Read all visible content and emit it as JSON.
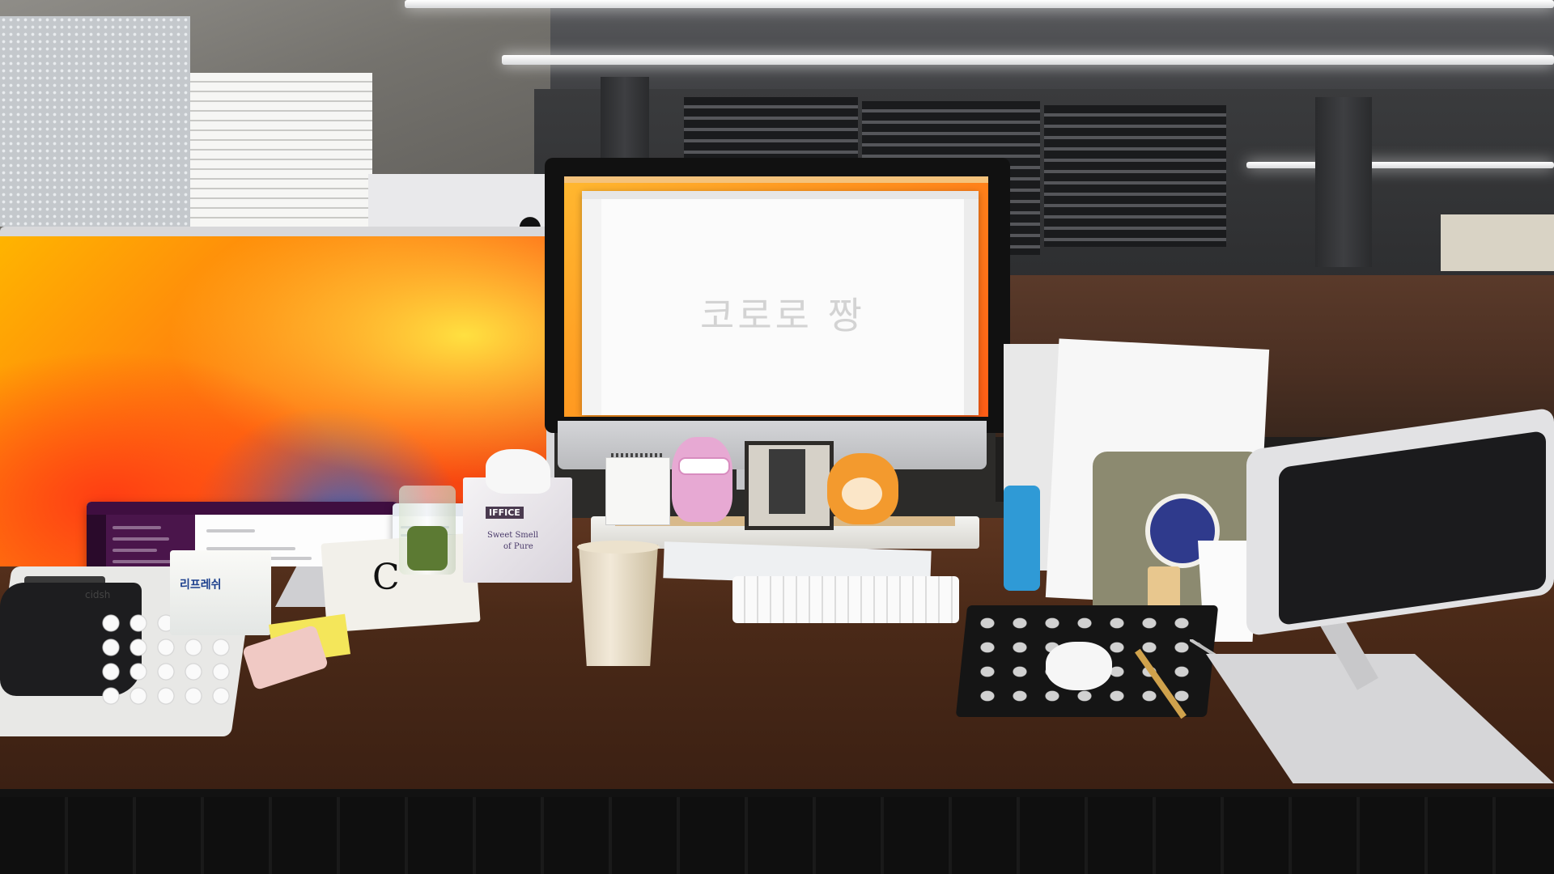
{
  "scene": {
    "imac_document_text": "코로로 짱",
    "tissue_box": {
      "brand": "IFFICE",
      "line1": "Sweet Smell",
      "line2": "of Pure"
    },
    "pill_box_label": "리프레쉬",
    "phone_brand": "cidsh",
    "apple_logo": "",
    "book_letter": "C"
  },
  "colors": {
    "wallpaper_orange": "#ff7a0f",
    "slack_purple": "#4a154b",
    "desk_wood": "#4b2a18",
    "tablet_stand": "#d6d6d8"
  },
  "icons": [
    "apple-logo-icon"
  ]
}
